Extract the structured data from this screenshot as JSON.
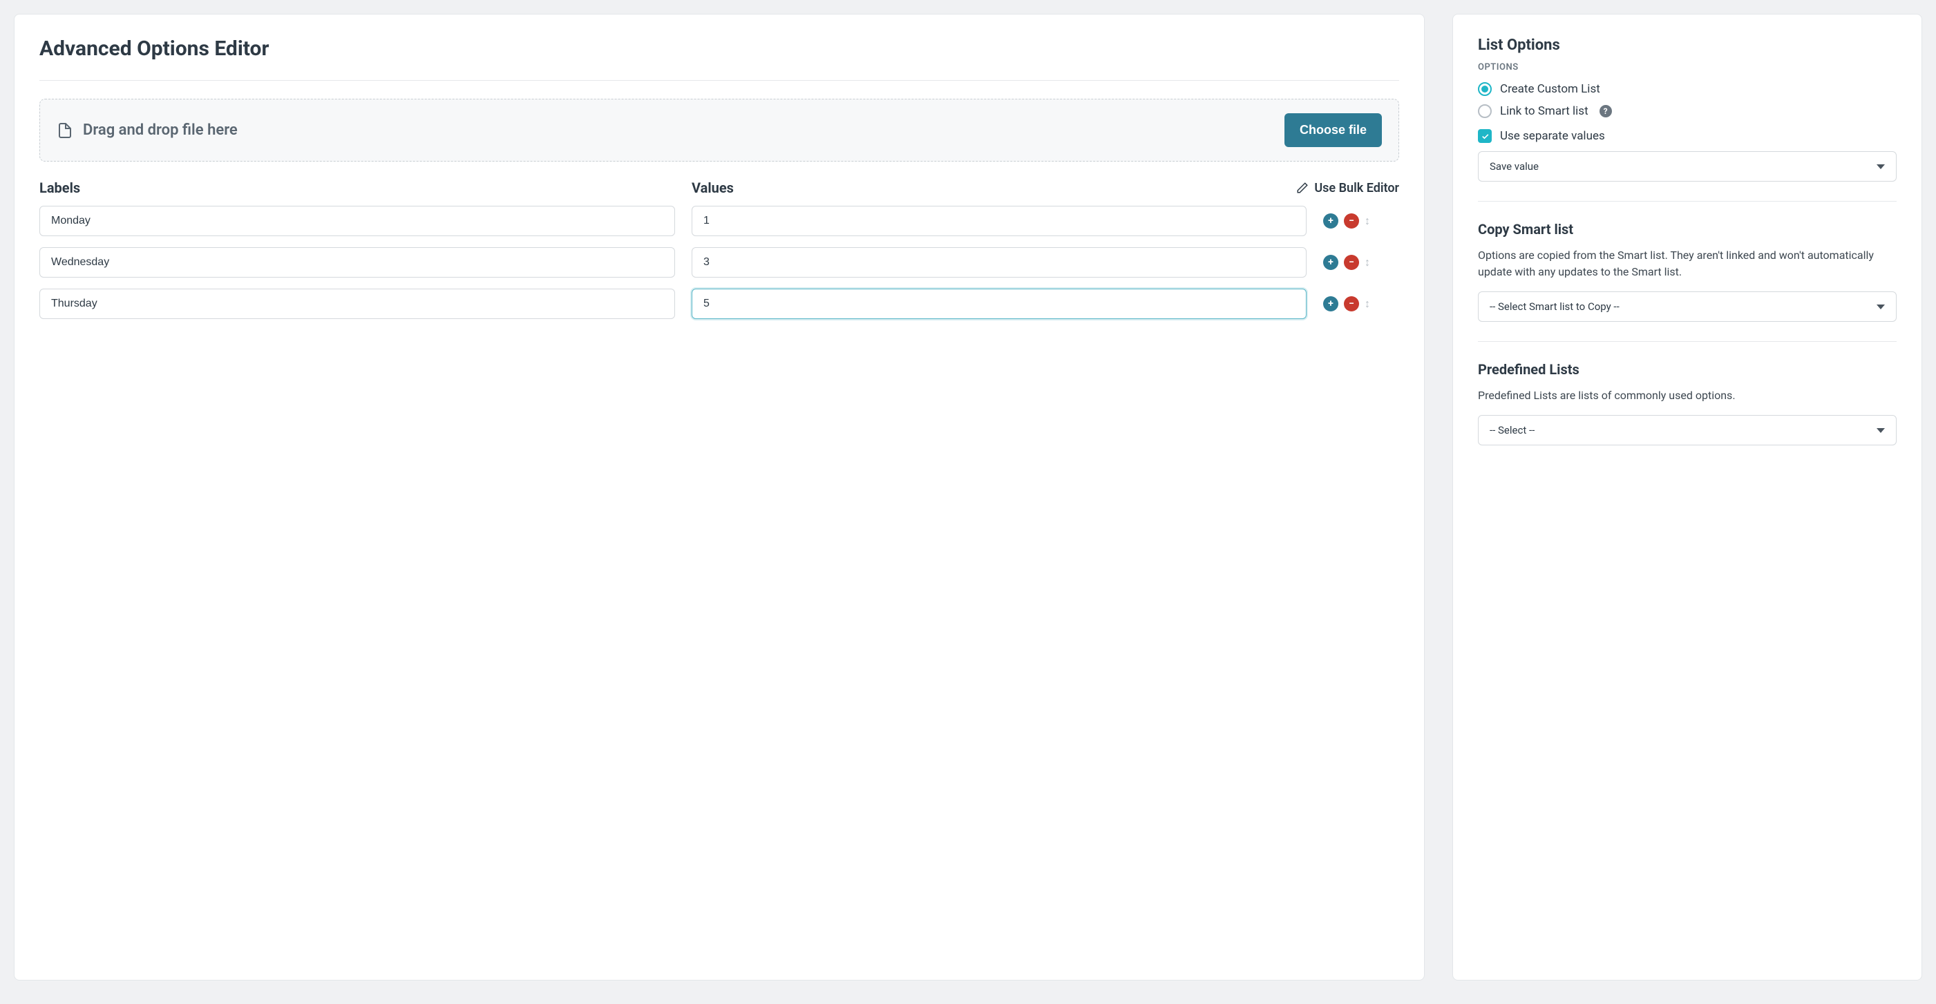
{
  "title": "Advanced Options Editor",
  "dropzone": {
    "text": "Drag and drop file here",
    "button": "Choose file"
  },
  "columns": {
    "labels_header": "Labels",
    "values_header": "Values",
    "bulk_editor": "Use Bulk Editor"
  },
  "rows": [
    {
      "label": "Monday",
      "value": "1",
      "active": false
    },
    {
      "label": "Wednesday",
      "value": "3",
      "active": false
    },
    {
      "label": "Thursday",
      "value": "5",
      "active": true
    }
  ],
  "side": {
    "title": "List Options",
    "options_label": "OPTIONS",
    "radios": {
      "create": "Create Custom List",
      "link": "Link to Smart list"
    },
    "radio_selected": "create",
    "use_separate_values": "Use separate values",
    "use_separate_checked": true,
    "save_mode_select": "Save value",
    "copy": {
      "heading": "Copy Smart list",
      "desc": "Options are copied from the Smart list. They aren't linked and won't automatically update with any updates to the Smart list.",
      "select": "-- Select Smart list to Copy --"
    },
    "predef": {
      "heading": "Predefined Lists",
      "desc": "Predefined Lists are lists of commonly used options.",
      "select": "-- Select --"
    }
  }
}
